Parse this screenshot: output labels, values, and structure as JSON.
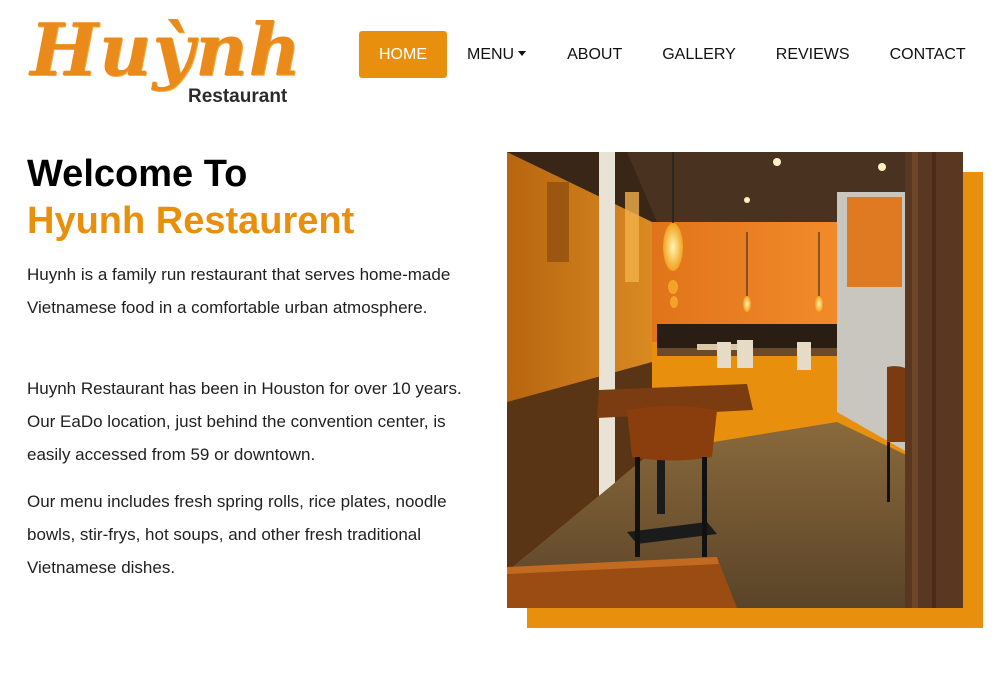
{
  "logo": {
    "main_text": "Huỳnh",
    "sub_text": "Restaurant"
  },
  "nav": {
    "items": [
      {
        "label": "HOME",
        "active": true
      },
      {
        "label": "MENU",
        "has_dropdown": true
      },
      {
        "label": "ABOUT"
      },
      {
        "label": "GALLERY"
      },
      {
        "label": "REVIEWS"
      },
      {
        "label": "CONTACT"
      }
    ]
  },
  "hero": {
    "heading_line1": "Welcome To",
    "heading_line2": "Hyunh Restaurent",
    "paragraphs": [
      "Huynh is a family run restaurant that serves home-made Vietnamese food in a comfortable urban atmosphere.",
      "Huynh Restaurant has been in Houston for over 10 years. Our EaDo location, just behind the convention center, is easily accessed from 59 or downtown.",
      "Our menu includes fresh spring rolls, rice plates, noodle bowls, stir-frys, hot soups, and other fresh traditional Vietnamese dishes."
    ]
  },
  "colors": {
    "accent": "#e8900d",
    "logo_orange": "#ea8a1a",
    "heading": "#000000",
    "body_text": "#1f1f1f"
  }
}
